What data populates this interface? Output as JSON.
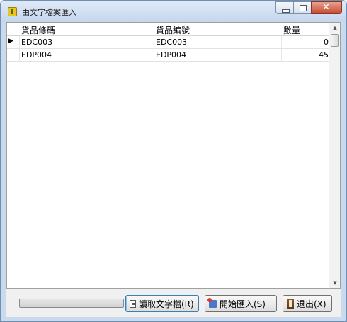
{
  "window": {
    "title": "由文字檔案匯入"
  },
  "grid": {
    "columns": [
      "貨品條碼",
      "貨品編號",
      "數量"
    ],
    "rows": [
      {
        "barcode": "EDC003",
        "item_no": "EDC003",
        "qty": "0",
        "current": true
      },
      {
        "barcode": "EDP004",
        "item_no": "EDP004",
        "qty": "45",
        "current": false
      }
    ],
    "current_row_indicator": "▶"
  },
  "progress": {
    "value": 0
  },
  "buttons": {
    "read_text_file": "讀取文字檔(R)",
    "start_import": "開始匯入(S)",
    "exit": "退出(X)"
  },
  "icons": {
    "app": "app-icon",
    "read": "document-icon",
    "import": "import-icon",
    "exit": "exit-door-icon"
  }
}
